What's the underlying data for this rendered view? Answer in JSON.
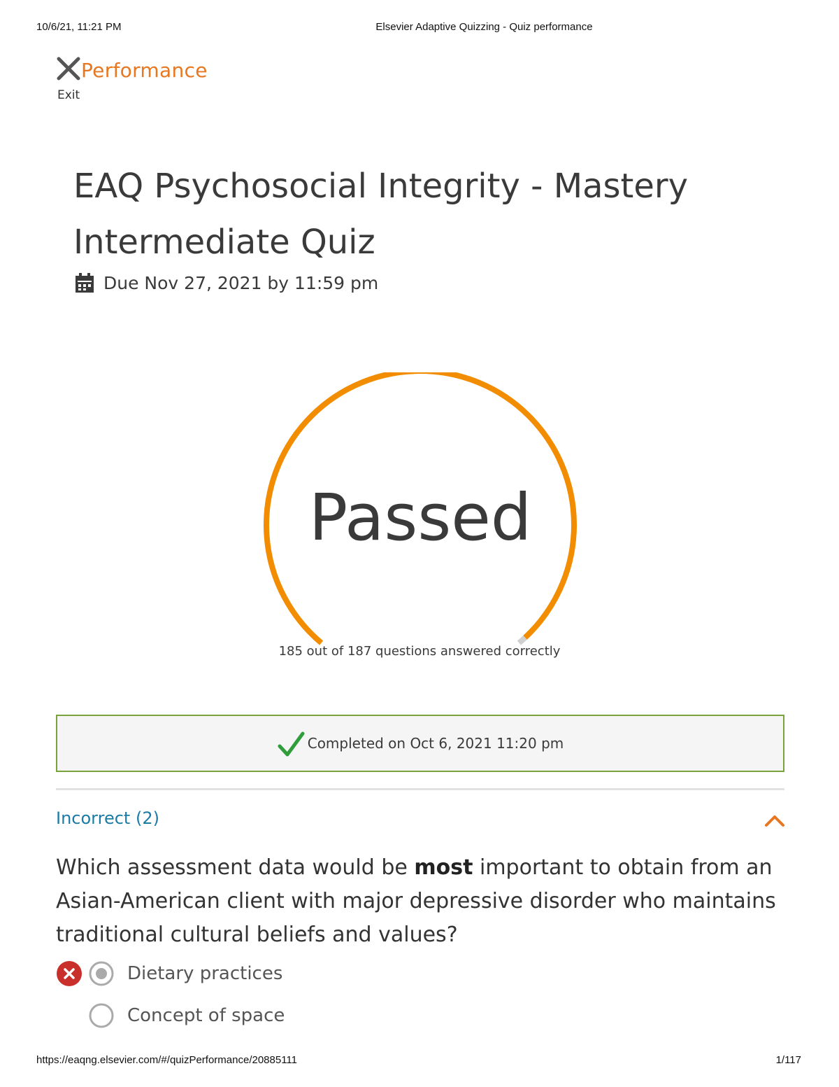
{
  "print_header": {
    "datetime": "10/6/21, 11:21 PM",
    "page_title": "Elsevier Adaptive Quizzing - Quiz performance"
  },
  "top_bar": {
    "exit_icon": "close-x-icon",
    "title": "Performance",
    "exit_label": "Exit"
  },
  "quiz": {
    "title": "EAQ Psychosocial Integrity - Mastery Intermediate Quiz",
    "due_icon": "calendar-icon",
    "due": "Due Nov 27, 2021 by 11:59 pm"
  },
  "result": {
    "status": "Passed",
    "correct": 185,
    "total": 187,
    "summary": "185 out of 187 questions answered correctly",
    "gauge_color": "#f28c00",
    "gauge_remainder_color": "#d0d0d0"
  },
  "completion": {
    "icon": "checkmark-icon",
    "text": "Completed on Oct 6, 2021 11:20 pm",
    "border_color": "#7aa33a"
  },
  "incorrect_section": {
    "label": "Incorrect (2)",
    "toggle_icon": "chevron-up-icon",
    "question": {
      "text_before": "Which assessment data would be ",
      "text_bold": "most",
      "text_after": " important to obtain from an Asian-American client with major depressive disorder who maintains traditional cultural beliefs and values?",
      "answers": [
        {
          "label": "Dietary practices",
          "selected": true,
          "marked": "incorrect"
        },
        {
          "label": "Concept of space",
          "selected": false
        }
      ]
    }
  },
  "print_footer": {
    "url": "https://eaqng.elsevier.com/#/quizPerformance/20885111",
    "page": "1/117"
  }
}
